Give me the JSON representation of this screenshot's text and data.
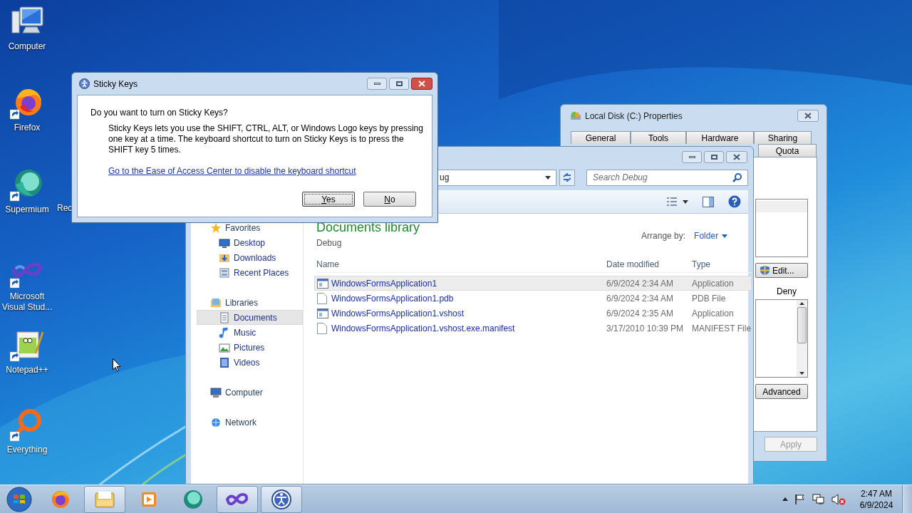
{
  "desktop_icons": [
    {
      "label": "Computer"
    },
    {
      "label": "Firefox"
    },
    {
      "label": "Supermium"
    },
    {
      "label": "Microsoft Visual Stud..."
    },
    {
      "label": "Notepad++"
    },
    {
      "label": "Everything"
    },
    {
      "label": "Rec"
    }
  ],
  "properties_window": {
    "title": "Local Disk (C:) Properties",
    "tabs": [
      {
        "label": "General",
        "selected": false
      },
      {
        "label": "Tools",
        "selected": false
      },
      {
        "label": "Hardware",
        "selected": false
      },
      {
        "label": "Sharing",
        "selected": false
      },
      {
        "label": "Quota",
        "selected": false
      }
    ],
    "edit_button": "Edit...",
    "permission_column": "Deny",
    "advanced_button": "Advanced",
    "apply_button": {
      "label": "Apply",
      "disabled": true
    }
  },
  "explorer": {
    "address_text": "ug",
    "search_placeholder": "Search Debug",
    "nav": [
      {
        "label": "Favorites",
        "selected": false,
        "children": [
          {
            "label": "Desktop",
            "selected": false
          },
          {
            "label": "Downloads",
            "selected": false
          },
          {
            "label": "Recent Places",
            "selected": false
          }
        ]
      },
      {
        "label": "Libraries",
        "selected": false,
        "children": [
          {
            "label": "Documents",
            "selected": true
          },
          {
            "label": "Music",
            "selected": false
          },
          {
            "label": "Pictures",
            "selected": false
          },
          {
            "label": "Videos",
            "selected": false
          }
        ]
      },
      {
        "label": "Computer",
        "selected": false
      },
      {
        "label": "Network",
        "selected": false
      }
    ],
    "library_title": "Documents library",
    "library_subtitle": "Debug",
    "arrange_label": "Arrange by:",
    "arrange_value": "Folder",
    "columns": [
      "Name",
      "Date modified",
      "Type"
    ],
    "files": [
      {
        "name": "WindowsFormsApplication1",
        "date": "6/9/2024 2:34 AM",
        "type": "Application",
        "kind": "app",
        "selected": true
      },
      {
        "name": "WindowsFormsApplication1.pdb",
        "date": "6/9/2024 2:34 AM",
        "type": "PDB File",
        "kind": "file",
        "selected": false
      },
      {
        "name": "WindowsFormsApplication1.vshost",
        "date": "6/9/2024 2:35 AM",
        "type": "Application",
        "kind": "app",
        "selected": false
      },
      {
        "name": "WindowsFormsApplication1.vshost.exe.manifest",
        "date": "3/17/2010 10:39 PM",
        "type": "MANIFEST File",
        "kind": "file",
        "selected": false
      }
    ]
  },
  "sticky_keys_dialog": {
    "title": "Sticky Keys",
    "question": "Do you want to turn on Sticky Keys?",
    "description": "Sticky Keys lets you use the SHIFT, CTRL, ALT, or Windows Logo keys by pressing one key at a time. The keyboard shortcut to turn on Sticky Keys is to press the SHIFT key 5 times.",
    "link": "Go to the Ease of Access Center to disable the keyboard shortcut",
    "buttons": [
      {
        "label": "Yes",
        "focused": true
      },
      {
        "label": "No",
        "focused": false
      }
    ]
  },
  "taskbar": {
    "apps": [
      {
        "open": false
      },
      {
        "open": true
      },
      {
        "open": false
      },
      {
        "open": false
      },
      {
        "open": true
      },
      {
        "open": true
      }
    ],
    "time": "2:47 AM",
    "date": "6/9/2024"
  }
}
